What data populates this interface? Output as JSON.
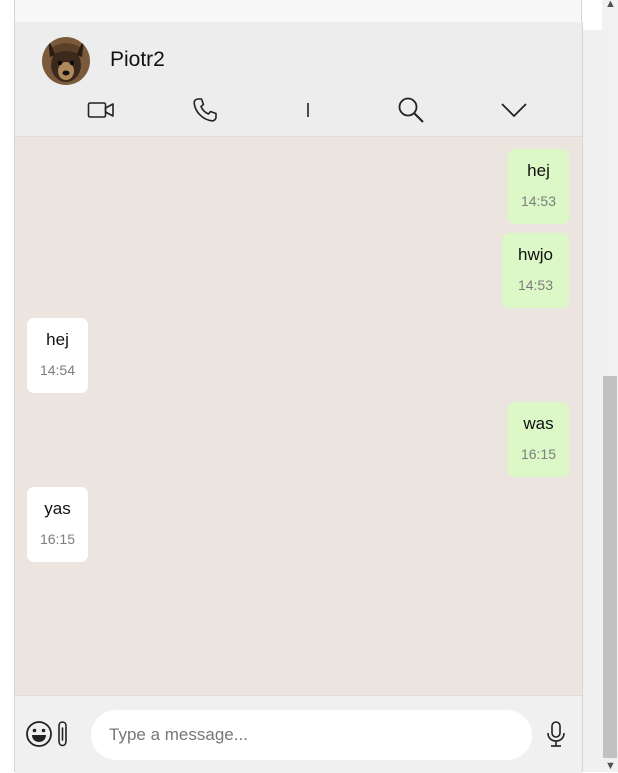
{
  "contact": {
    "name": "Piotr2",
    "avatar_icon": "dog-avatar"
  },
  "header_actions": [
    {
      "name": "video-call",
      "icon": "video-camera-icon"
    },
    {
      "name": "voice-call",
      "icon": "phone-icon"
    },
    {
      "name": "divider",
      "icon": "separator-bar"
    },
    {
      "name": "search",
      "icon": "search-icon"
    },
    {
      "name": "more",
      "icon": "chevron-down-icon"
    }
  ],
  "messages": [
    {
      "direction": "out",
      "text": "hej",
      "time": "14:53"
    },
    {
      "direction": "out",
      "text": "hwjo",
      "time": "14:53"
    },
    {
      "direction": "in",
      "text": "hej",
      "time": "14:54"
    },
    {
      "direction": "out",
      "text": "was",
      "time": "16:15"
    },
    {
      "direction": "in",
      "text": "yas",
      "time": "16:15"
    }
  ],
  "composer": {
    "placeholder": "Type a message...",
    "value": ""
  },
  "colors": {
    "chat_background": "#ece5df",
    "outgoing_bubble": "#dcf8c6",
    "incoming_bubble": "#ffffff",
    "header_background": "#ededed"
  }
}
